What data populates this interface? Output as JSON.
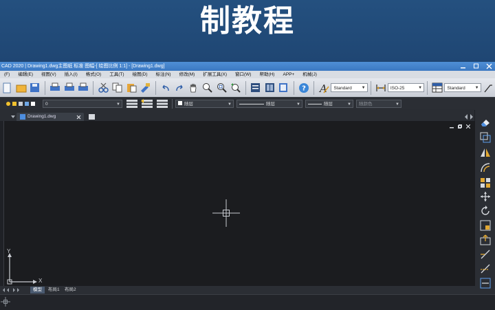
{
  "banner": {
    "title": "制教程"
  },
  "titlebar": {
    "text": "CAD 2020 | Drawing1.dwg主图纸  标准  图幅-[ 绘图比例 1:1] - [Drawing1.dwg]"
  },
  "menu": [
    "(F)",
    "编辑(E)",
    "视图(V)",
    "插入(I)",
    "格式(O)",
    "工具(T)",
    "绘图(D)",
    "标注(N)",
    "修改(M)",
    "扩展工具(X)",
    "窗口(W)",
    "帮助(H)",
    "APP+",
    "机械(J)"
  ],
  "toolbar": {
    "text_style": "Standard",
    "dim_style": "ISO-25",
    "table_style": "Standard"
  },
  "layer_bar": {
    "layer_name": "0",
    "color": "随层",
    "linetype": "随层",
    "lineweight": "随层",
    "plotstyle": "随颜色"
  },
  "document_tab": {
    "label": "Drawing1.dwg"
  },
  "layout_tabs": [
    "模型",
    "布局1",
    "布局2"
  ],
  "ucs": {
    "x_label": "X",
    "y_label": "Y"
  },
  "colors": {
    "banner": "#1f4673",
    "titlebar": "#3b78c2",
    "canvas": "#1b1c1f",
    "panel": "#2b2e34"
  },
  "icons": [
    "new-icon",
    "open-icon",
    "save-icon",
    "print-icon",
    "print-preview-icon",
    "plot-icon",
    "cut-icon",
    "copy-icon",
    "paste-icon",
    "match-properties-icon",
    "undo-icon",
    "redo-icon",
    "pan-icon",
    "zoom-realtime-icon",
    "zoom-window-icon",
    "zoom-previous-icon",
    "properties-icon",
    "design-center-icon",
    "tool-palette-icon",
    "help-icon",
    "text-style-icon",
    "dim-style-icon",
    "table-style-icon"
  ]
}
